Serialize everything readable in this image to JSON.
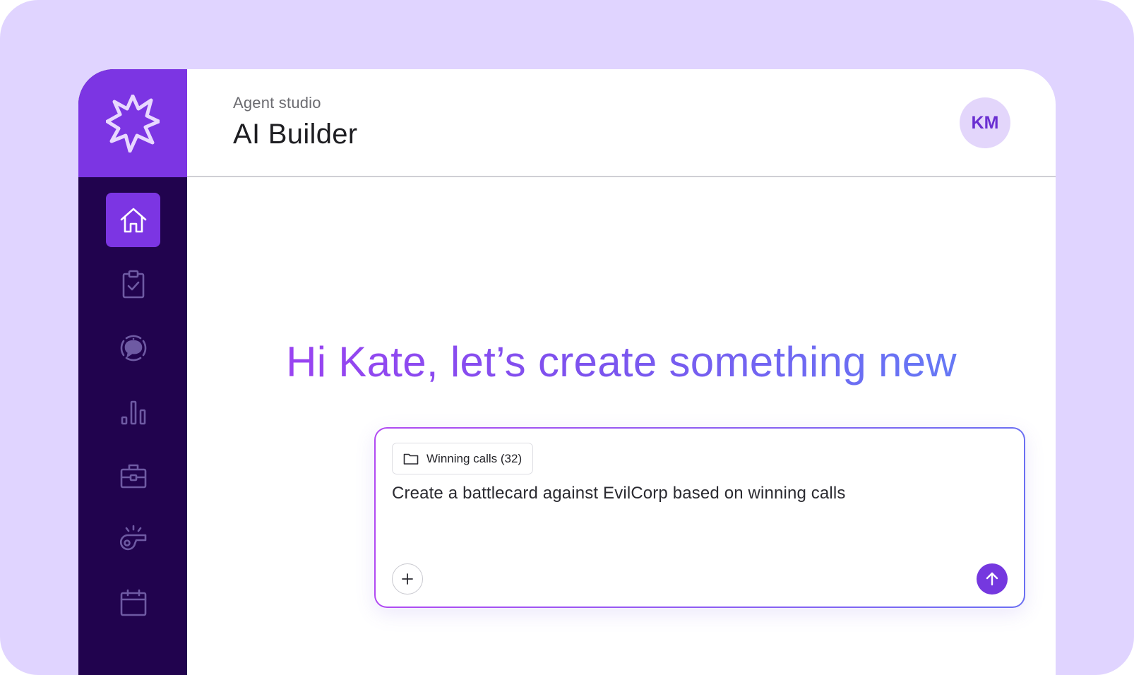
{
  "header": {
    "subtitle": "Agent studio",
    "title": "AI Builder",
    "avatar_initials": "KM"
  },
  "sidebar": {
    "logo_icon": "burst-logo-icon",
    "items": [
      {
        "icon": "home-icon",
        "active": true
      },
      {
        "icon": "clipboard-check-icon",
        "active": false
      },
      {
        "icon": "chat-bubble-icon",
        "active": false
      },
      {
        "icon": "bar-chart-icon",
        "active": false
      },
      {
        "icon": "briefcase-icon",
        "active": false
      },
      {
        "icon": "whistle-icon",
        "active": false
      },
      {
        "icon": "calendar-icon",
        "active": false
      }
    ]
  },
  "main": {
    "greeting": "Hi Kate, let’s create something new",
    "composer": {
      "chip_label": "Winning calls (32)",
      "prompt": "Create a battlecard against EvilCorp based on winning calls",
      "add_icon": "plus-icon",
      "send_icon": "arrow-up-icon"
    }
  },
  "colors": {
    "backdrop": "#e0d4ff",
    "sidebar": "#21034e",
    "accent": "#7c35e3",
    "gradient_start": "#a33ef2",
    "gradient_end": "#5f82f7"
  }
}
